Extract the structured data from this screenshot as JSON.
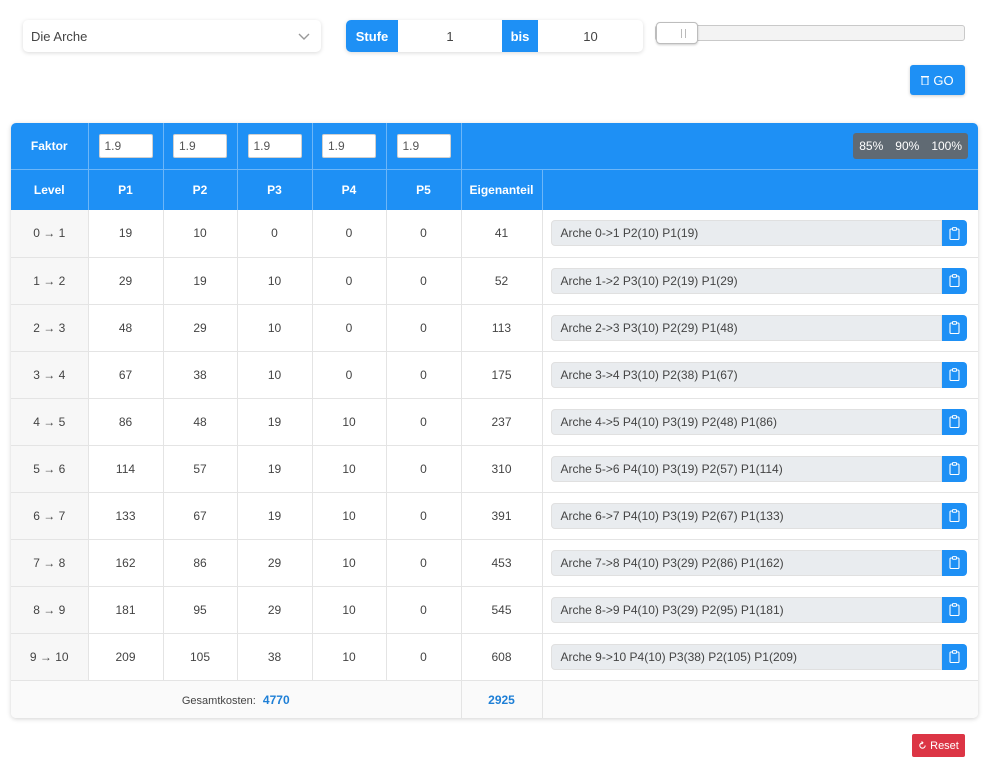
{
  "building_select": {
    "value": "Die Arche"
  },
  "range": {
    "stufe_label": "Stufe",
    "from": "1",
    "bis_label": "bis",
    "to": "10"
  },
  "go_button": {
    "label": "GO"
  },
  "faktor": {
    "label": "Faktor",
    "values": [
      "1.9",
      "1.9",
      "1.9",
      "1.9",
      "1.9"
    ]
  },
  "percent_buttons": [
    "85%",
    "90%",
    "100%"
  ],
  "columns": [
    "Level",
    "P1",
    "P2",
    "P3",
    "P4",
    "P5",
    "Eigenanteil"
  ],
  "rows": [
    {
      "level": "0 → 1",
      "p1": "19",
      "p2": "10",
      "p3": "0",
      "p4": "0",
      "p5": "0",
      "eigen": "41",
      "text": "Arche 0->1 P2(10) P1(19)"
    },
    {
      "level": "1 → 2",
      "p1": "29",
      "p2": "19",
      "p3": "10",
      "p4": "0",
      "p5": "0",
      "eigen": "52",
      "text": "Arche 1->2 P3(10) P2(19) P1(29)"
    },
    {
      "level": "2 → 3",
      "p1": "48",
      "p2": "29",
      "p3": "10",
      "p4": "0",
      "p5": "0",
      "eigen": "113",
      "text": "Arche 2->3 P3(10) P2(29) P1(48)"
    },
    {
      "level": "3 → 4",
      "p1": "67",
      "p2": "38",
      "p3": "10",
      "p4": "0",
      "p5": "0",
      "eigen": "175",
      "text": "Arche 3->4 P3(10) P2(38) P1(67)"
    },
    {
      "level": "4 → 5",
      "p1": "86",
      "p2": "48",
      "p3": "19",
      "p4": "10",
      "p5": "0",
      "eigen": "237",
      "text": "Arche 4->5 P4(10) P3(19) P2(48) P1(86)"
    },
    {
      "level": "5 → 6",
      "p1": "114",
      "p2": "57",
      "p3": "19",
      "p4": "10",
      "p5": "0",
      "eigen": "310",
      "text": "Arche 5->6 P4(10) P3(19) P2(57) P1(114)"
    },
    {
      "level": "6 → 7",
      "p1": "133",
      "p2": "67",
      "p3": "19",
      "p4": "10",
      "p5": "0",
      "eigen": "391",
      "text": "Arche 6->7 P4(10) P3(19) P2(67) P1(133)"
    },
    {
      "level": "7 → 8",
      "p1": "162",
      "p2": "86",
      "p3": "29",
      "p4": "10",
      "p5": "0",
      "eigen": "453",
      "text": "Arche 7->8 P4(10) P3(29) P2(86) P1(162)"
    },
    {
      "level": "8 → 9",
      "p1": "181",
      "p2": "95",
      "p3": "29",
      "p4": "10",
      "p5": "0",
      "eigen": "545",
      "text": "Arche 8->9 P4(10) P3(29) P2(95) P1(181)"
    },
    {
      "level": "9 → 10",
      "p1": "209",
      "p2": "105",
      "p3": "38",
      "p4": "10",
      "p5": "0",
      "eigen": "608",
      "text": "Arche 9->10 P4(10) P3(38) P2(105) P1(209)"
    }
  ],
  "totals": {
    "label": "Gesamtkosten:",
    "cost": "4770",
    "eigen": "2925"
  },
  "reset_button": {
    "label": "Reset"
  },
  "colors": {
    "accent": "#1e90f5",
    "danger": "#dc3545",
    "total_text": "#1e7fd6"
  }
}
